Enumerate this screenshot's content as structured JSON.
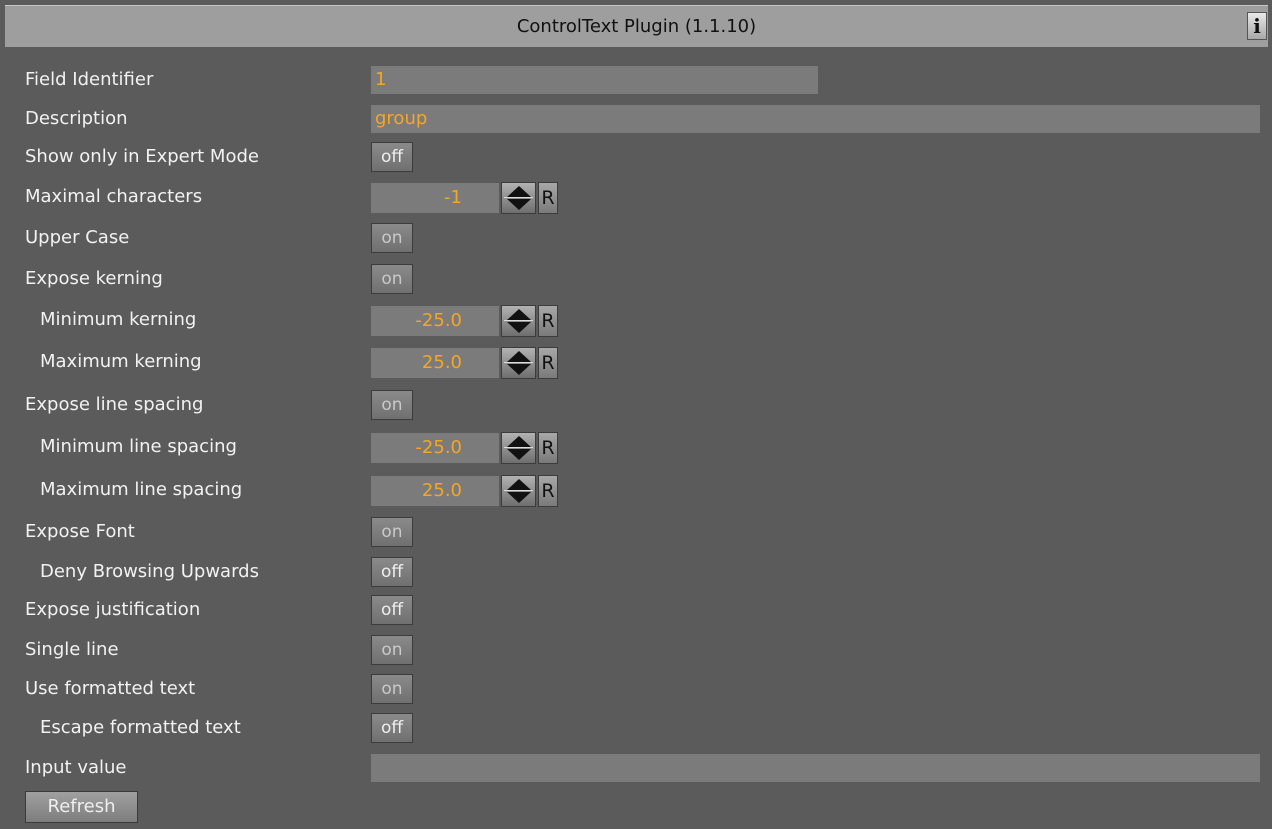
{
  "title": "ControlText Plugin (1.1.10)",
  "info_label": "i",
  "fields": {
    "field_identifier": {
      "label": "Field Identifier",
      "value": "1"
    },
    "description": {
      "label": "Description",
      "value": "group"
    },
    "show_expert": {
      "label": "Show only in Expert Mode",
      "value": "off"
    },
    "max_chars": {
      "label": "Maximal characters",
      "value": "-1"
    },
    "upper_case": {
      "label": "Upper Case",
      "value": "on"
    },
    "expose_kerning": {
      "label": "Expose kerning",
      "value": "on"
    },
    "min_kerning": {
      "label": "Minimum kerning",
      "value": "-25.0"
    },
    "max_kerning": {
      "label": "Maximum kerning",
      "value": "25.0"
    },
    "expose_line_spacing": {
      "label": "Expose line spacing",
      "value": "on"
    },
    "min_line_spacing": {
      "label": "Minimum line spacing",
      "value": "-25.0"
    },
    "max_line_spacing": {
      "label": "Maximum line spacing",
      "value": "25.0"
    },
    "expose_font": {
      "label": "Expose Font",
      "value": "on"
    },
    "deny_browsing": {
      "label": "Deny Browsing Upwards",
      "value": "off"
    },
    "expose_justification": {
      "label": "Expose justification",
      "value": "off"
    },
    "single_line": {
      "label": "Single line",
      "value": "on"
    },
    "use_formatted": {
      "label": "Use formatted text",
      "value": "on"
    },
    "escape_formatted": {
      "label": "Escape formatted text",
      "value": "off"
    },
    "input_value": {
      "label": "Input value",
      "value": ""
    }
  },
  "reset_label": "R",
  "refresh_label": "Refresh",
  "colors": {
    "background": "#5b5b5b",
    "title_bar": "#9e9e9e",
    "value_text": "#f5a623",
    "field_bg": "#7b7b7b"
  }
}
